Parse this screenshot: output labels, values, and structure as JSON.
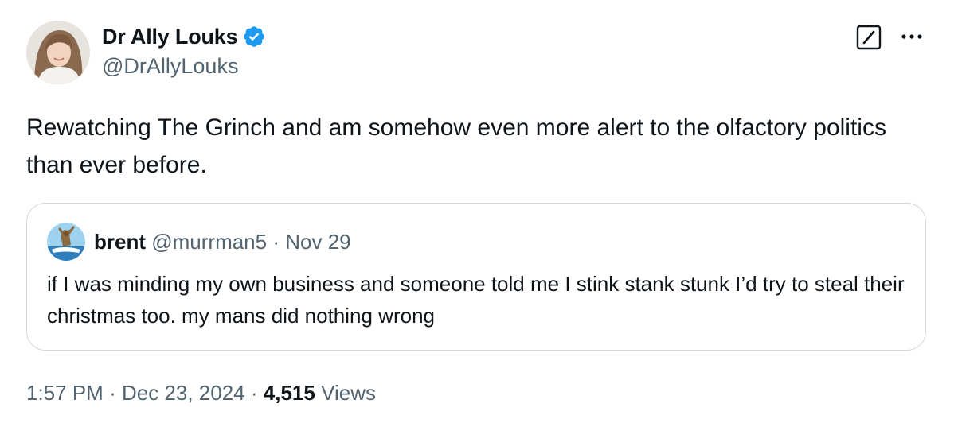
{
  "author": {
    "display_name": "Dr Ally Louks",
    "handle": "@DrAllyLouks",
    "verified": true
  },
  "tweet": {
    "text": "Rewatching The Grinch and am somehow even more alert to the olfactory politics than ever before."
  },
  "quoted_tweet": {
    "display_name": "brent",
    "handle": "@murrman5",
    "separator": "·",
    "date": "Nov 29",
    "text": "if I was minding my own business and someone told me I stink stank stunk I’d try to steal their christmas too. my mans did nothing wrong"
  },
  "footer": {
    "time": "1:57 PM",
    "date": "Dec 23, 2024",
    "separator": "·",
    "views_count": "4,515",
    "views_label": "Views"
  },
  "icons": {
    "verified": "verified-badge-icon",
    "grok": "grok-icon",
    "more": "more-options-icon"
  },
  "colors": {
    "text_primary": "#0f1419",
    "text_secondary": "#536471",
    "verified_blue": "#1d9bf0",
    "border": "#cfd9de"
  }
}
